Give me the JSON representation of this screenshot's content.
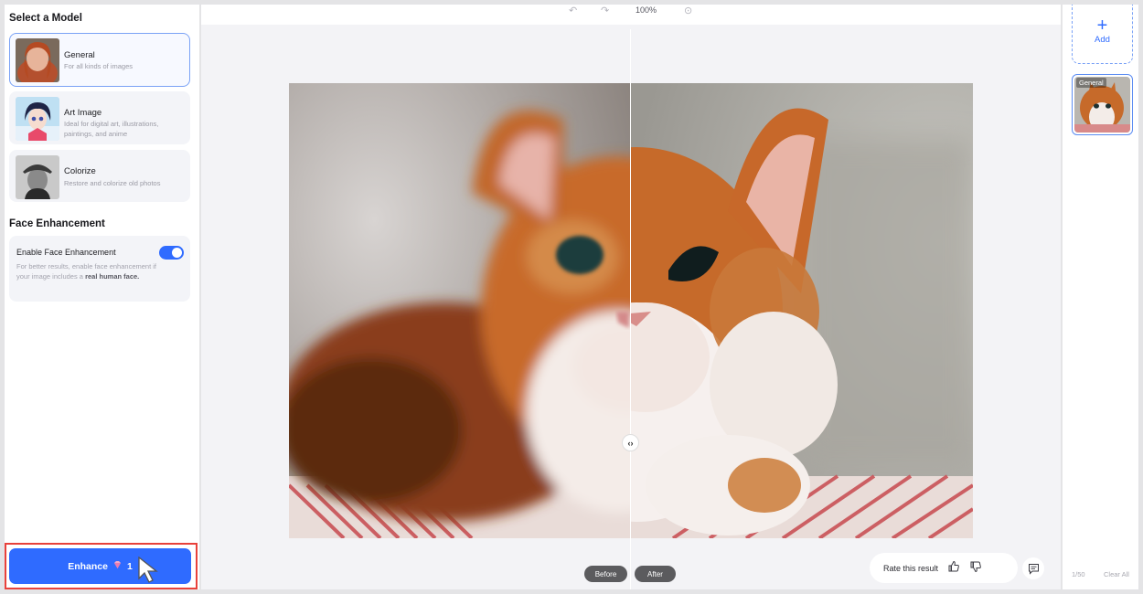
{
  "sidebar": {
    "select_title": "Select a Model",
    "models": [
      {
        "name": "General",
        "desc": "For all kinds of images",
        "selected": true
      },
      {
        "name": "Art Image",
        "desc": "Ideal for digital art, illustrations, paintings, and anime"
      },
      {
        "name": "Colorize",
        "desc": "Restore and colorize old photos"
      }
    ],
    "face_title": "Face Enhancement",
    "face_toggle_label": "Enable Face Enhancement",
    "face_toggle_on": true,
    "face_desc": "For better results, enable face enhancement if your image includes a",
    "face_desc_bold": "real human face."
  },
  "enhance": {
    "label": "Enhance",
    "credits": "1",
    "icon": "gem-icon"
  },
  "toolbar": {
    "zoom": "100%",
    "undo_icon": "undo-icon",
    "redo_icon": "redo-icon",
    "reset_icon": "reset-icon"
  },
  "compare": {
    "before": "Before",
    "after": "After",
    "handle": "‹›"
  },
  "rating": {
    "label": "Rate this result"
  },
  "history": {
    "add_label": "Add",
    "add_symbol": "+",
    "item_tag": "General",
    "count": "1/50",
    "clear_label": "Clear All"
  },
  "colors": {
    "accent": "#2f6bff",
    "highlight": "#e8413b"
  }
}
